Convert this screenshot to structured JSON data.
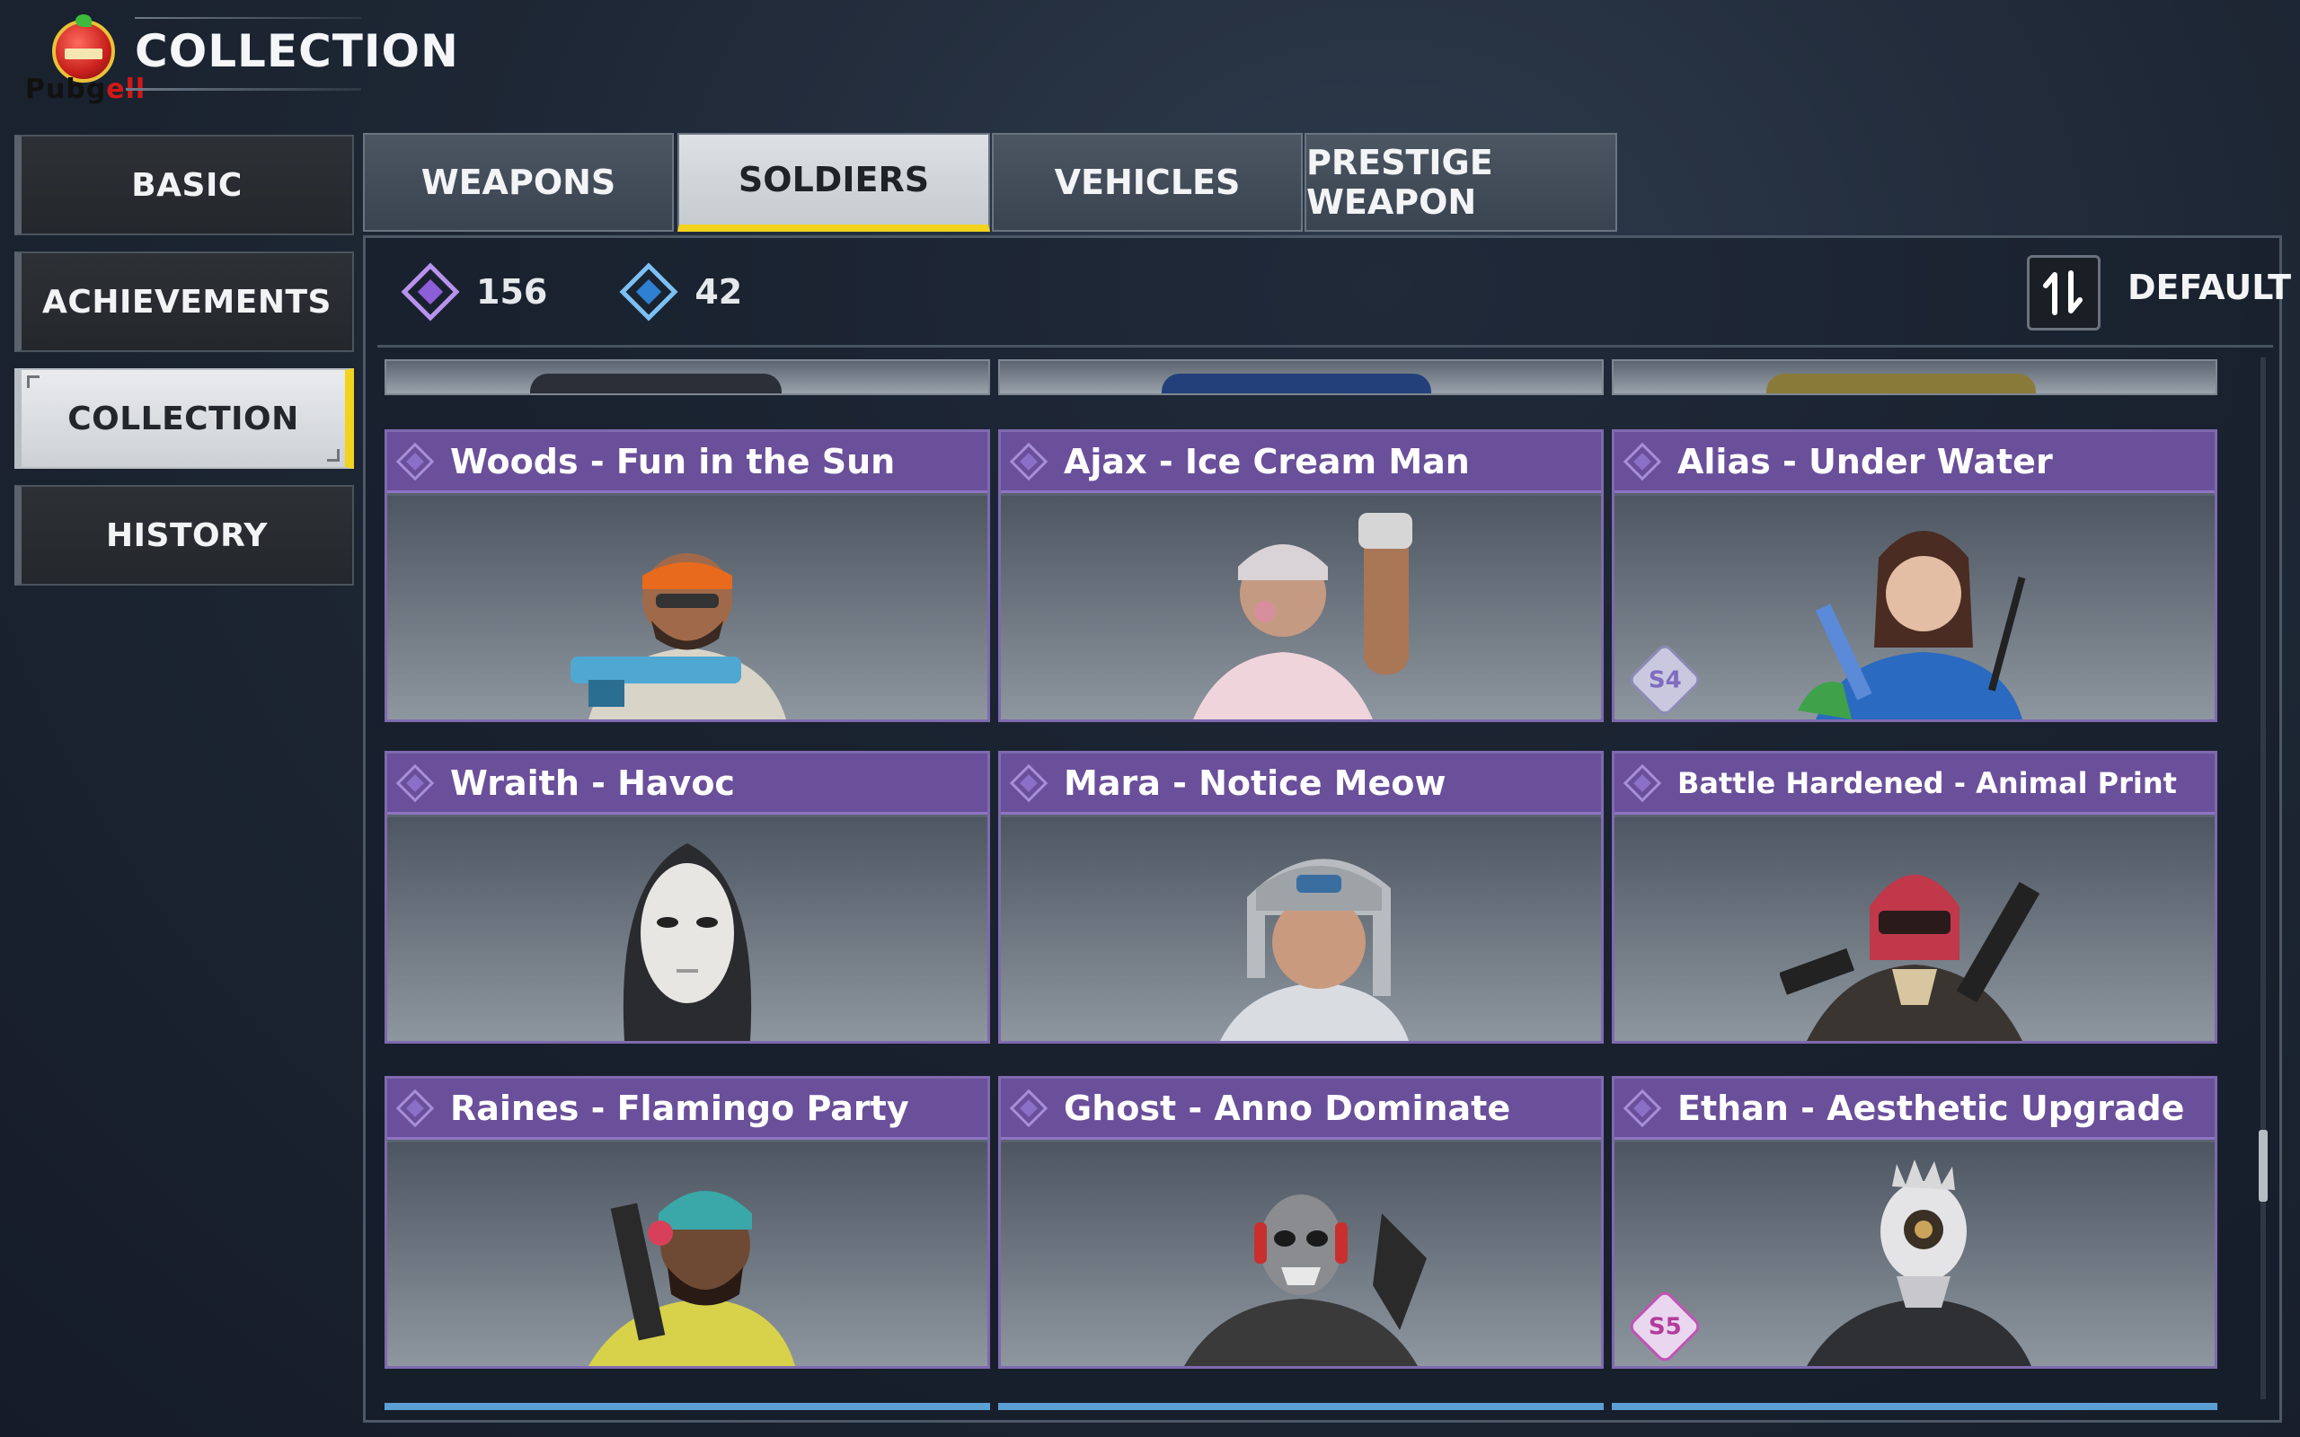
{
  "header": {
    "title": "COLLECTION",
    "logo_text": "Pubg",
    "logo_text_accent": "ell"
  },
  "sidebar": {
    "items": [
      {
        "label": "BASIC",
        "active": false
      },
      {
        "label": "ACHIEVEMENTS",
        "active": false
      },
      {
        "label": "COLLECTION",
        "active": true
      },
      {
        "label": "HISTORY",
        "active": false
      }
    ]
  },
  "tabs": [
    {
      "label": "WEAPONS",
      "active": false
    },
    {
      "label": "SOLDIERS",
      "active": true
    },
    {
      "label": "VEHICLES",
      "active": false
    },
    {
      "label": "PRESTIGE WEAPON",
      "active": false
    }
  ],
  "stats": {
    "purple_count": "156",
    "blue_count": "42"
  },
  "sort": {
    "label": "DEFAULT",
    "icon": "sort-toggle-icon"
  },
  "cards": [
    {
      "title": "Woods - Fun in the Sun",
      "badge": ""
    },
    {
      "title": "Ajax - Ice Cream Man",
      "badge": ""
    },
    {
      "title": "Alias - Under Water",
      "badge": "S4"
    },
    {
      "title": "Wraith - Havoc",
      "badge": ""
    },
    {
      "title": "Mara - Notice Meow",
      "badge": ""
    },
    {
      "title": "Battle Hardened - Animal Print",
      "badge": ""
    },
    {
      "title": "Raines - Flamingo Party",
      "badge": ""
    },
    {
      "title": "Ghost - Anno Dominate",
      "badge": ""
    },
    {
      "title": "Ethan - Aesthetic Upgrade",
      "badge": "S5"
    }
  ],
  "colors": {
    "accent_yellow": "#f2d31d",
    "card_purple": "#6a4f9a",
    "rarity_purple": "#b793ee",
    "rarity_blue": "#7cc0f4"
  }
}
